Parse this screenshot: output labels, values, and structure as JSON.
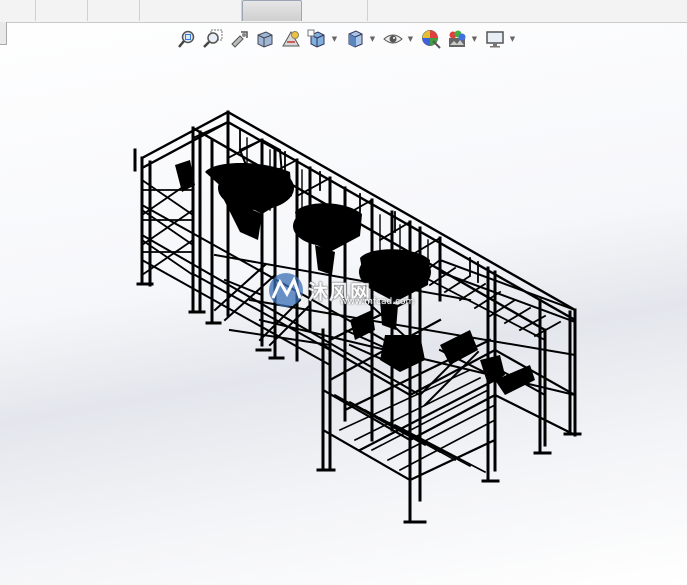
{
  "tabs": [
    {
      "label": ""
    },
    {
      "label": ""
    },
    {
      "label": ""
    },
    {
      "label": ""
    },
    {
      "label": ""
    },
    {
      "label": ""
    },
    {
      "label": ""
    },
    {
      "label": ""
    }
  ],
  "heads_up_toolbar": {
    "buttons": [
      "zoom-to-fit-icon",
      "zoom-to-area-icon",
      "previous-view-icon",
      "section-view-icon",
      "dynamic-annotation-icon",
      "view-orientation-icon",
      "display-style-icon",
      "hide-show-items-icon",
      "edit-appearance-icon",
      "apply-scene-icon",
      "view-settings-icon"
    ]
  },
  "watermark": {
    "text": "沐风网",
    "url": "www.mfcad.com"
  },
  "colors": {
    "model_lines": "#000000",
    "watermark_logo": "#3a6fb5",
    "tab_bar": "#f3f3f3"
  }
}
